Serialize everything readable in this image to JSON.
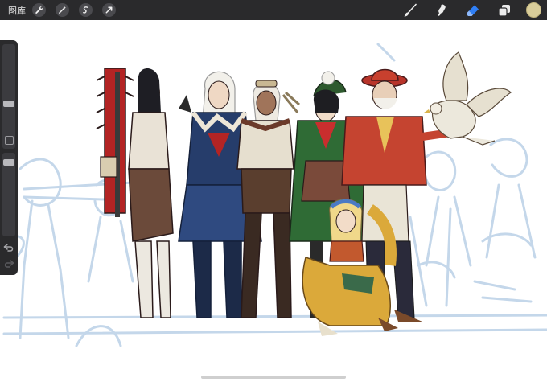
{
  "toolbar": {
    "gallery_label": "图库",
    "left_tools": [
      {
        "icon": "wrench-icon"
      },
      {
        "icon": "magic-wand-icon"
      },
      {
        "icon": "selection-icon"
      },
      {
        "icon": "transform-arrow-icon"
      }
    ],
    "right_tools": [
      {
        "icon": "brush-icon",
        "active": false
      },
      {
        "icon": "smudge-icon",
        "active": false
      },
      {
        "icon": "eraser-icon",
        "active": true
      },
      {
        "icon": "layers-icon",
        "active": false
      }
    ],
    "current_color": "#d9cd9a",
    "active_color": "#2f7ff6"
  },
  "sidebar": {
    "brush_size_level": 0.25,
    "opacity_level": 0.07,
    "icons": [
      "modify-square-icon",
      "undo-icon",
      "redo-icon"
    ]
  },
  "canvas": {
    "content": "illustration-of-fantasy-adventurers"
  }
}
